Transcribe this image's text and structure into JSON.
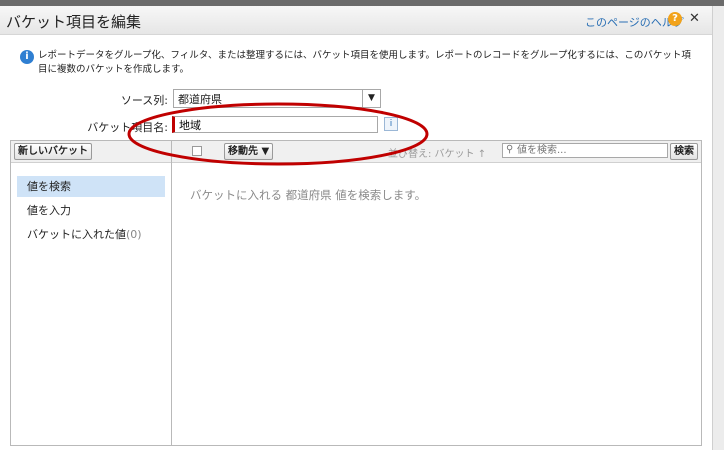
{
  "dialog": {
    "title": "バケット項目を編集",
    "help_link": "このページのヘルプ",
    "help_icon": "?",
    "close_icon": "✕"
  },
  "intro": {
    "text": "レポートデータをグループ化、フィルタ、または整理するには、バケット項目を使用します。レポートのレコードをグループ化するには、このバケット項目に複数のバケットを作成します。",
    "icon": "i"
  },
  "form": {
    "source_label": "ソース列:",
    "source_value": "都道府県",
    "name_label": "バケット項目名:",
    "name_value": "地域",
    "info_icon": "i"
  },
  "workspace": {
    "new_bucket_button": "新しいバケット",
    "nav_items": [
      {
        "label": "値を検索"
      },
      {
        "label": "値を入力"
      },
      {
        "label": "バケットに入れた値",
        "count": "(0)"
      }
    ],
    "move_button": "移動先 ▼",
    "sort_label": "並び替え: バケット ↑",
    "search_placeholder": "値を検索...",
    "search_button": "検索",
    "hint": "バケットに入れる 都道府県 値を検索します。"
  },
  "colors": {
    "annotation": "#c00000",
    "active_nav": "#cfe3f7",
    "link": "#2a6fb4"
  }
}
